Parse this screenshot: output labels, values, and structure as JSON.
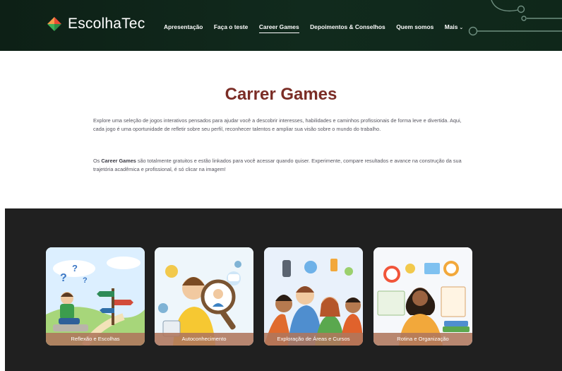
{
  "header": {
    "logo_text": "EscolhaTec",
    "nav": [
      {
        "label": "Apresentação"
      },
      {
        "label": "Faça o teste"
      },
      {
        "label": "Career Games",
        "active": true
      },
      {
        "label": "Depoimentos & Conselhos"
      },
      {
        "label": "Quem somos"
      },
      {
        "label": "Mais"
      }
    ],
    "more_icon": "chevron-down-icon"
  },
  "intro": {
    "title": "Carrer Games",
    "paragraph1": "Explore uma seleção de jogos interativos pensados para ajudar você a descobrir interesses, habilidades e caminhos profissionais de forma leve e divertida. Aqui, cada jogo é uma oportunidade de refletir sobre seu perfil, reconhecer talentos e ampliar sua visão sobre o mundo do trabalho.",
    "paragraph2_prefix": "Os ",
    "paragraph2_bold": "Career Games",
    "paragraph2_rest": " são totalmente gratuitos e estão linkados para você acessar quando quiser. Experimente, compare resultados e avance na construção da sua trajetória acadêmica e profissional, é só clicar na imagem!"
  },
  "games": [
    {
      "label": "Reflexão e Escolhas"
    },
    {
      "label": "Autoconhecimento"
    },
    {
      "label": "Exploração de Áreas e Cursos"
    },
    {
      "label": "Rotina e Organização"
    }
  ],
  "colors": {
    "header_bg": "#0f241a",
    "title": "#7b2d26",
    "games_bg": "#202020",
    "card_label_bg": "#af765c"
  }
}
